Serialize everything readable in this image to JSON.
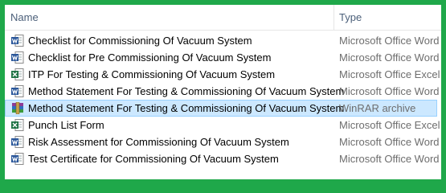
{
  "header": {
    "name_label": "Name",
    "type_label": "Type"
  },
  "files": [
    {
      "name": "Checklist for Commissioning Of Vacuum System",
      "type": "Microsoft Office Word",
      "icon": "word-document-icon",
      "selected": false
    },
    {
      "name": "Checklist for Pre Commissioning Of Vacuum System",
      "type": "Microsoft Office Word",
      "icon": "word-document-icon",
      "selected": false
    },
    {
      "name": "ITP For Testing & Commissioning Of Vacuum System",
      "type": "Microsoft Office Excel",
      "icon": "excel-document-icon",
      "selected": false
    },
    {
      "name": "Method Statement For Testing & Commissioning Of Vacuum System",
      "type": "Microsoft Office Word",
      "icon": "word-document-icon",
      "selected": false
    },
    {
      "name": "Method Statement For Testing & Commissioning Of Vacuum System",
      "type": "WinRAR archive",
      "icon": "winrar-archive-icon",
      "selected": true
    },
    {
      "name": "Punch List Form",
      "type": "Microsoft Office Excel",
      "icon": "excel-document-icon",
      "selected": false
    },
    {
      "name": "Risk Assessment for Commissioning Of Vacuum System",
      "type": "Microsoft Office Word",
      "icon": "word-document-icon",
      "selected": false
    },
    {
      "name": "Test Certificate for Commissioning Of Vacuum System",
      "type": "Microsoft Office Word",
      "icon": "word-document-icon",
      "selected": false
    }
  ],
  "colors": {
    "frame": "#1fa84a",
    "selection_fill": "#cce8ff",
    "selection_border": "#99d1ff",
    "word": "#2b579a",
    "excel": "#217346"
  }
}
